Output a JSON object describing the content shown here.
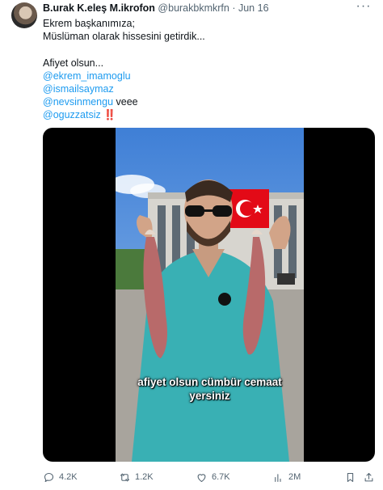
{
  "tweet": {
    "author_name": "B.urak K.eleş M.ikrofon",
    "handle": "@burakbkmkrfn",
    "separator": "·",
    "date": "Jun 16",
    "more": "···",
    "lines": [
      {
        "text": "Ekrem başkanımıza;"
      },
      {
        "text": "Müslüman olarak hissesini getirdik..."
      },
      {
        "text": ""
      },
      {
        "text": "Afiyet olsun..."
      }
    ],
    "mentions": [
      "@ekrem_imamoglu",
      "@ismailsaymaz",
      "@nevsinmengu",
      "@oguzzatsiz"
    ],
    "mention_suffix": " veee",
    "emoji": "‼️",
    "video_caption": {
      "line1": "afiyet olsun cümbür cemaat",
      "line2": "yersiniz"
    },
    "actions": {
      "replies": "4.2K",
      "retweets": "1.2K",
      "likes": "6.7K",
      "views": "2M"
    }
  },
  "colors": {
    "link": "#1d9bf0",
    "secondary": "#536471",
    "flag": "#e30a17"
  },
  "icons": [
    "more-icon",
    "reply-icon",
    "retweet-icon",
    "like-icon",
    "views-icon",
    "bookmark-icon",
    "share-icon"
  ]
}
